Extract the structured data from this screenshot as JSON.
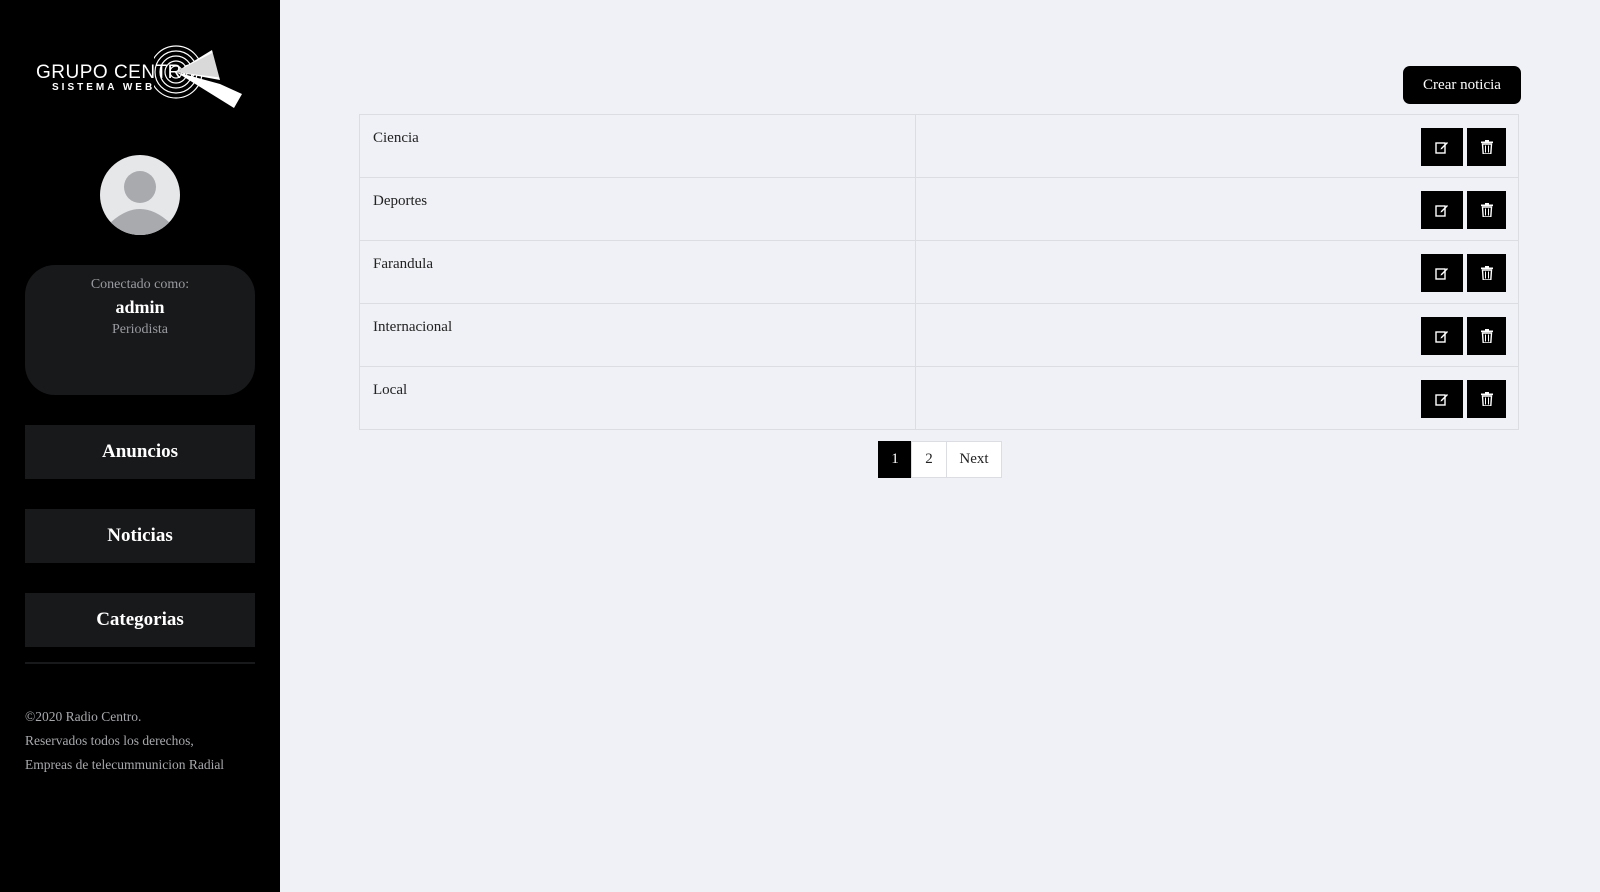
{
  "brand": {
    "logo_text": "GRUPO CENTRO",
    "logo_sub": "SISTEMA WEB"
  },
  "user": {
    "label": "Conectado como:",
    "name": "admin",
    "role": "Periodista"
  },
  "nav": {
    "items": [
      {
        "label": "Anuncios"
      },
      {
        "label": "Noticias"
      },
      {
        "label": "Categorias"
      }
    ]
  },
  "footer": {
    "line1": "©2020 Radio Centro.",
    "line2": "Reservados todos los derechos,",
    "line3": "Empreas de telecummunicion Radial"
  },
  "actions": {
    "create_label": "Crear noticia"
  },
  "table": {
    "rows": [
      {
        "name": "Ciencia"
      },
      {
        "name": "Deportes"
      },
      {
        "name": "Farandula"
      },
      {
        "name": "Internacional"
      },
      {
        "name": "Local"
      }
    ]
  },
  "pagination": {
    "page1": "1",
    "page2": "2",
    "next": "Next",
    "current": 1
  },
  "icons": {
    "edit": "edit-icon",
    "delete": "trash-icon",
    "avatar": "user-avatar-icon"
  },
  "colors": {
    "sidebar": "#000000",
    "background": "#f0f1f6",
    "card": "#18191b",
    "accent": "#000000"
  }
}
